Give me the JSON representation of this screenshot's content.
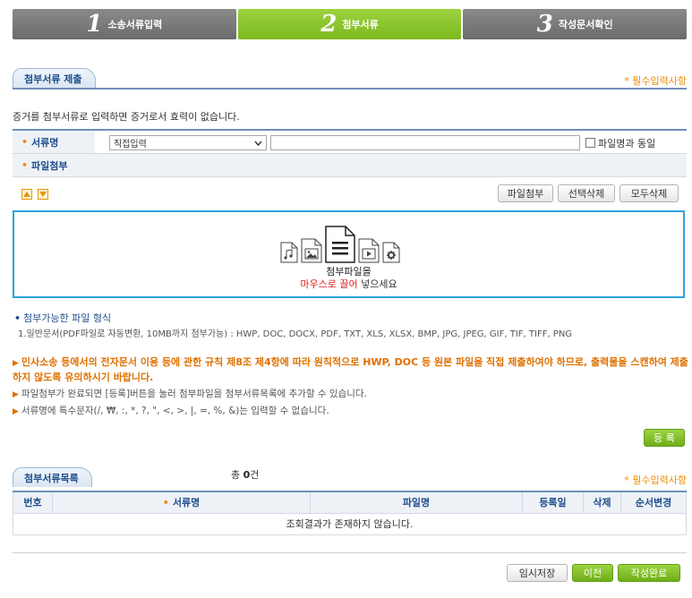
{
  "steps": [
    {
      "num": "1",
      "label": "소송서류입력",
      "active": false
    },
    {
      "num": "2",
      "label": "첨부서류",
      "active": true
    },
    {
      "num": "3",
      "label": "작성문서확인",
      "active": false
    }
  ],
  "submit_section": {
    "tab": "첨부서류 제출",
    "required_note": "* 필수입력사항",
    "description": "증거를 첨부서류로 입력하면 증거로서 효력이 없습니다."
  },
  "form": {
    "doc_name_label": "서류명",
    "doc_select_value": "직접입력",
    "doc_name_input": "",
    "same_as_filename": "파일명과 동일",
    "file_attach_label": "파일첨부"
  },
  "file_buttons": {
    "attach": "파일첨부",
    "delete_selected": "선택삭제",
    "delete_all": "모두삭제"
  },
  "dropzone": {
    "line1": "첨부파일을",
    "drag": "마우스로 끌어",
    "line2_rest": " 넣으세요"
  },
  "formats": {
    "title": "첨부가능한 파일 형식",
    "desc": "1.일반문서(PDF파일로 자동변환, 10MB까지 첨부가능) : HWP, DOC, DOCX, PDF, TXT, XLS, XLSX, BMP, JPG, JPEG, GIF, TIF, TIFF, PNG"
  },
  "notes": {
    "warning": "민사소송 등에서의 전자문서 이용 등에 관한 규칙 제8조 제4항에 따라 원칙적으로 HWP, DOC 등 원본 파일을 직접 제출하여야 하므로, 출력물을 스캔하여 제출하지 않도록 유의하시기 바랍니다.",
    "info1": "파일첨부가 완료되면 [등록]버튼을 눌러 첨부파일을 첨부서류목록에 추가할 수 있습니다.",
    "info2": "서류명에 특수문자(/, ₩, :, *, ?, \", <, >, |, =, %, &)는 입력할 수 없습니다."
  },
  "register_button": "등 록",
  "list_section": {
    "tab": "첨부서류목록",
    "count_prefix": "총 ",
    "count": "0",
    "count_suffix": "건",
    "required_note": "* 필수입력사항",
    "columns": [
      "번호",
      "서류명",
      "파일명",
      "등록일",
      "삭제",
      "순서변경"
    ],
    "empty": "조회결과가 존재하지 않습니다."
  },
  "footer_buttons": {
    "temp_save": "임시저장",
    "prev": "이전",
    "complete": "작성완료"
  },
  "colors": {
    "green": "#7cb91f",
    "blue": "#1f4e8c",
    "orange": "#f08c00",
    "drop_border": "#2ea3e0"
  }
}
